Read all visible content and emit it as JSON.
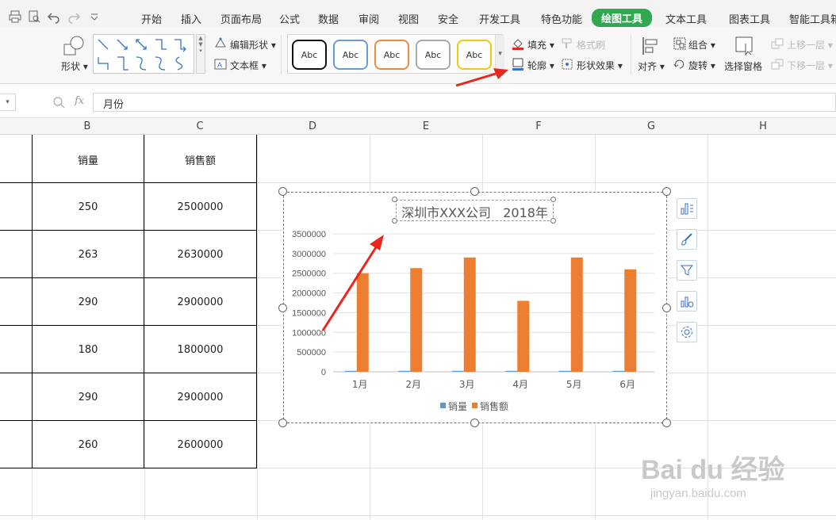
{
  "quick_access": [
    "print-icon",
    "print-preview-icon",
    "undo-icon",
    "redo-icon",
    "customize-icon"
  ],
  "menu": {
    "tabs": [
      "开始",
      "插入",
      "页面布局",
      "公式",
      "数据",
      "审阅",
      "视图",
      "安全",
      "开发工具",
      "特色功能",
      "绘图工具",
      "文本工具",
      "图表工具",
      "智能工具箱"
    ],
    "active": "绘图工具"
  },
  "ribbon": {
    "shape_label": "形状",
    "edit_shape": "编辑形状",
    "text_box": "文本框",
    "style_sample": "Abc",
    "fill": "填充",
    "format_painter": "格式刷",
    "outline": "轮廓",
    "shape_effects": "形状效果",
    "align": "对齐",
    "group": "组合",
    "rotate": "旋转",
    "selection_pane": "选择窗格",
    "bring_forward": "上移一层",
    "send_backward": "下移一层"
  },
  "formula_bar": {
    "fx": "fx",
    "value": "月份"
  },
  "columns": [
    "B",
    "C",
    "D",
    "E",
    "F",
    "G",
    "H"
  ],
  "table": {
    "headers": [
      "销量",
      "销售额"
    ],
    "rows": [
      [
        "250",
        "2500000"
      ],
      [
        "263",
        "2630000"
      ],
      [
        "290",
        "2900000"
      ],
      [
        "180",
        "1800000"
      ],
      [
        "290",
        "2900000"
      ],
      [
        "260",
        "2600000"
      ]
    ]
  },
  "chart_data": {
    "type": "bar",
    "title": "深圳市XXX公司   2018年",
    "categories": [
      "1月",
      "2月",
      "3月",
      "4月",
      "5月",
      "6月"
    ],
    "series": [
      {
        "name": "销量",
        "values": [
          250,
          263,
          290,
          180,
          290,
          260
        ],
        "color": "#5b9bd5"
      },
      {
        "name": "销售额",
        "values": [
          2500000,
          2630000,
          2900000,
          1800000,
          2900000,
          2600000
        ],
        "color": "#ed7d31"
      }
    ],
    "yticks": [
      "0",
      "500000",
      "1000000",
      "1500000",
      "2000000",
      "2500000",
      "3000000",
      "3500000"
    ],
    "ylim": [
      0,
      3500000
    ],
    "grid": true,
    "legend": "bottom"
  },
  "chart_side_tools": [
    "chart-elements-icon",
    "chart-style-icon",
    "chart-filter-icon",
    "chart-type-icon",
    "chart-settings-icon"
  ],
  "watermark": {
    "brand": "Bai du 经验",
    "url": "jingyan.baidu.com"
  },
  "colors": {
    "accent_green": "#2fa84f",
    "series1": "#5b9bd5",
    "series2": "#ed7d31",
    "annotation_red": "#e8261c"
  }
}
